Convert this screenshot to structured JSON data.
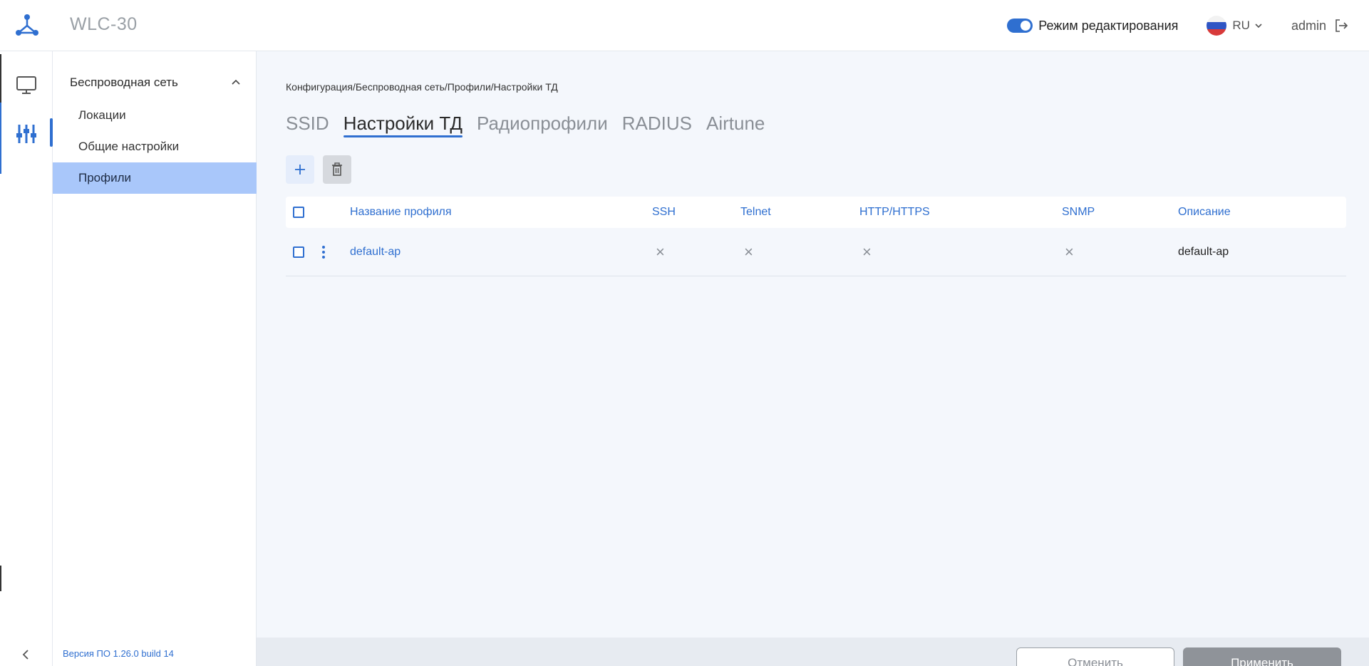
{
  "app": {
    "title": "WLC-30"
  },
  "header": {
    "edit_mode_label": "Режим редактирования",
    "language": "RU",
    "user": "admin"
  },
  "subnav": {
    "section_title": "Беспроводная сеть",
    "items": [
      {
        "label": "Локации"
      },
      {
        "label": "Общие настройки"
      },
      {
        "label": "Профили"
      }
    ],
    "version": "Версия ПО 1.26.0 build 14"
  },
  "main": {
    "breadcrumb": "Конфигурация/Беспроводная сеть/Профили/Настройки ТД",
    "tabs": [
      {
        "label": "SSID"
      },
      {
        "label": "Настройки ТД"
      },
      {
        "label": "Радиопрофили"
      },
      {
        "label": "RADIUS"
      },
      {
        "label": "Airtune"
      }
    ],
    "table": {
      "columns": [
        "Название профиля",
        "SSH",
        "Telnet",
        "HTTP/HTTPS",
        "SNMP",
        "Описание"
      ],
      "rows": [
        {
          "name": "default-ap",
          "ssh": "×",
          "telnet": "×",
          "http": "×",
          "snmp": "×",
          "description": "default-ap"
        }
      ]
    }
  },
  "footer": {
    "cancel": "Отменить",
    "apply": "Применить"
  },
  "colors": {
    "accent": "#2f6fd0",
    "active_nav": "#a9c7fa"
  }
}
